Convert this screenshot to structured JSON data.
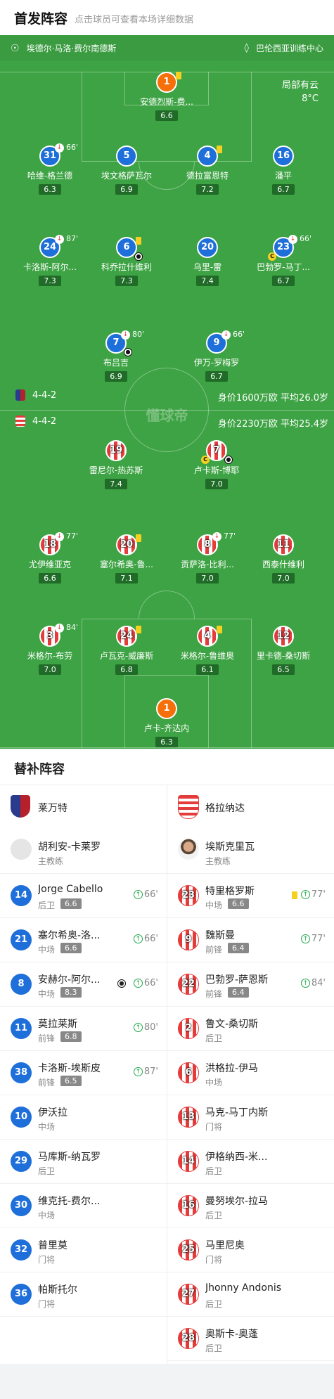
{
  "header": {
    "title": "首发阵容",
    "subtitle": "点击球员可查看本场详细数据"
  },
  "venue": {
    "stadium": "埃德尔·马洛·费尔南德斯",
    "training": "巴伦西亚训练中心",
    "weather": "局部有云",
    "temp": "8°C",
    "watermark": "懂球帝"
  },
  "home": {
    "formation": "4-4-2",
    "value": "身价1600万欧 平均26.0岁",
    "players": [
      {
        "num": "1",
        "name": "安德烈斯-费...",
        "rating": "6.6",
        "kind": "orange",
        "marks": "yc"
      },
      {
        "num": "31",
        "name": "哈维-格兰德",
        "rating": "6.3",
        "kind": "blue",
        "sub": "66'"
      },
      {
        "num": "5",
        "name": "埃文格萨瓦尔",
        "rating": "6.9",
        "kind": "blue"
      },
      {
        "num": "4",
        "name": "德拉富恩特",
        "rating": "7.2",
        "kind": "blue",
        "marks": "yc"
      },
      {
        "num": "16",
        "name": "潘平",
        "rating": "6.7",
        "kind": "blue"
      },
      {
        "num": "24",
        "name": "卡洛斯-阿尔...",
        "rating": "7.3",
        "kind": "blue",
        "sub": "87'"
      },
      {
        "num": "6",
        "name": "科乔拉什维利",
        "rating": "7.3",
        "kind": "blue",
        "marks": "yc"
      },
      {
        "num": "20",
        "name": "乌里-雷",
        "rating": "7.4",
        "kind": "blue"
      },
      {
        "num": "23",
        "name": "巴勃罗-马丁...",
        "rating": "6.7",
        "kind": "blue",
        "sub": "66'"
      },
      {
        "num": "7",
        "name": "布吕吉",
        "rating": "6.9",
        "kind": "blue",
        "sub": "80'"
      },
      {
        "num": "9",
        "name": "伊万-罗梅罗",
        "rating": "6.7",
        "kind": "blue",
        "sub": "66'"
      }
    ]
  },
  "away": {
    "formation": "4-4-2",
    "value": "身价2230万欧 平均25.4岁",
    "players": [
      {
        "num": "19",
        "name": "雷尼尔-热苏斯",
        "rating": "7.4",
        "kind": "stripe"
      },
      {
        "num": "7",
        "name": "卢卡斯-博耶",
        "rating": "7.0",
        "kind": "stripe"
      },
      {
        "num": "18",
        "name": "尤伊维亚克",
        "rating": "6.6",
        "kind": "stripe",
        "sub": "77'"
      },
      {
        "num": "20",
        "name": "塞尔希奥-鲁...",
        "rating": "7.1",
        "kind": "stripe",
        "marks": "yc"
      },
      {
        "num": "8",
        "name": "贡萨洛-比利...",
        "rating": "7.0",
        "kind": "stripe",
        "sub": "77'"
      },
      {
        "num": "11",
        "name": "西泰什维利",
        "rating": "7.0",
        "kind": "stripe"
      },
      {
        "num": "3",
        "name": "米格尔-布劳",
        "rating": "7.0",
        "kind": "stripe",
        "sub": "84'"
      },
      {
        "num": "24",
        "name": "卢瓦克-威廉斯",
        "rating": "6.8",
        "kind": "stripe",
        "marks": "yc"
      },
      {
        "num": "4",
        "name": "米格尔-鲁维奥",
        "rating": "6.1",
        "kind": "stripe",
        "marks": "yc"
      },
      {
        "num": "12",
        "name": "里卡德-桑切斯",
        "rating": "6.5",
        "kind": "stripe"
      },
      {
        "num": "1",
        "name": "卢卡-齐达内",
        "rating": "6.3",
        "kind": "orange"
      }
    ]
  },
  "subs": {
    "title": "替补阵容",
    "left_team": "莱万特",
    "right_team": "格拉纳达",
    "left_coach": "胡利安-卡莱罗",
    "right_coach": "埃斯克里瓦",
    "coach_label": "主教练",
    "left": [
      {
        "num": "14",
        "name": "Jorge Cabello",
        "pos": "后卫",
        "rating": "6.6",
        "sub": "66'"
      },
      {
        "num": "21",
        "name": "塞尔希奥-洛...",
        "pos": "中场",
        "rating": "6.6",
        "sub": "66'"
      },
      {
        "num": "8",
        "name": "安赫尔-阿尔...",
        "pos": "中场",
        "rating": "8.3",
        "sub": "66'",
        "goal": true
      },
      {
        "num": "11",
        "name": "莫拉莱斯",
        "pos": "前锋",
        "rating": "6.8",
        "sub": "80'"
      },
      {
        "num": "38",
        "name": "卡洛斯-埃斯皮",
        "pos": "前锋",
        "rating": "6.5",
        "sub": "87'"
      },
      {
        "num": "10",
        "name": "伊沃拉",
        "pos": "中场"
      },
      {
        "num": "29",
        "name": "马库斯-纳瓦罗",
        "pos": "后卫"
      },
      {
        "num": "30",
        "name": "维克托-费尔...",
        "pos": "中场"
      },
      {
        "num": "32",
        "name": "普里莫",
        "pos": "门将"
      },
      {
        "num": "36",
        "name": "帕斯托尔",
        "pos": "门将"
      }
    ],
    "right": [
      {
        "num": "23",
        "name": "特里格罗斯",
        "pos": "中场",
        "rating": "6.6",
        "sub": "77'",
        "yc": true
      },
      {
        "num": "9",
        "name": "魏斯曼",
        "pos": "前锋",
        "rating": "6.4",
        "sub": "77'"
      },
      {
        "num": "22",
        "name": "巴勃罗-萨恩斯",
        "pos": "前锋",
        "rating": "6.4",
        "sub": "84'"
      },
      {
        "num": "2",
        "name": "鲁文-桑切斯",
        "pos": "后卫"
      },
      {
        "num": "6",
        "name": "洪格拉-伊马",
        "pos": "中场"
      },
      {
        "num": "13",
        "name": "马克-马丁内斯",
        "pos": "门将"
      },
      {
        "num": "14",
        "name": "伊格纳西-米...",
        "pos": "后卫"
      },
      {
        "num": "16",
        "name": "曼努埃尔-拉马",
        "pos": "后卫"
      },
      {
        "num": "25",
        "name": "马里尼奥",
        "pos": "门将"
      },
      {
        "num": "27",
        "name": "Jhonny Andonis",
        "pos": "后卫"
      },
      {
        "num": "28",
        "name": "奥斯卡-奥蓬",
        "pos": "后卫"
      }
    ]
  },
  "colors": {
    "pitch": "#3ea344",
    "home": "#1e6fd9",
    "gk": "#f5700a",
    "away": "#e43b3b",
    "up": "#22a84a"
  }
}
